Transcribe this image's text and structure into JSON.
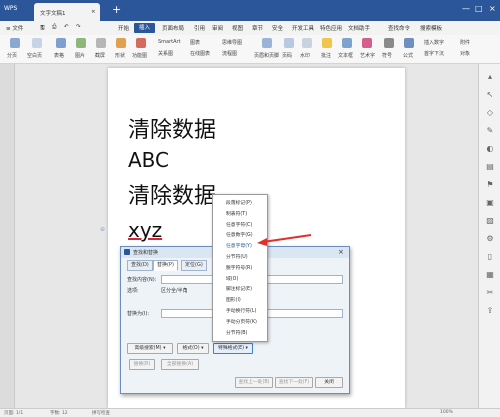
{
  "titlebar": {
    "app": "WPS",
    "tab": "文字文稿1",
    "close": "×",
    "new_tab": "+"
  },
  "menu": {
    "file": "≡ 文件",
    "items": [
      "开始",
      "插入",
      "页面布局",
      "引用",
      "审阅",
      "视图",
      "章节",
      "安全",
      "开发工具",
      "特色应用",
      "文档助手"
    ],
    "right": [
      "查找命令",
      "搜索模板"
    ],
    "active_index": 1
  },
  "ribbon": {
    "labels": [
      "分页",
      "空白页",
      "表格",
      "图片",
      "截屏",
      "形状",
      "功能图",
      "SmartArt",
      "关系图",
      "图表",
      "在线图表",
      "思维导图",
      "流程图",
      "页眉和页脚",
      "页码",
      "水印",
      "批注",
      "文本框",
      "艺术字",
      "符号",
      "公式",
      "插入数字",
      "首字下沉",
      "附件",
      "对象"
    ]
  },
  "document": {
    "lines": [
      "清除数据",
      "ABC",
      "清除数据",
      "xyz"
    ]
  },
  "dialog": {
    "title": "查找和替换",
    "tabs": [
      "查找(D)",
      "替换(P)",
      "定位(G)"
    ],
    "find_label": "查找内容(N):",
    "options_label": "选项:",
    "options_value": "区分全/半角",
    "replace_label": "替换为(I):",
    "btn_advanced": "高级搜索(M) ▾",
    "btn_format": "格式(O) ▾",
    "btn_special": "特殊格式(E) ▾",
    "btn_replace": "替换(R)",
    "btn_replace_all": "全部替换(A)",
    "btn_find_prev": "查找上一处(B)",
    "btn_find_next": "查找下一处(F)",
    "btn_close": "关闭"
  },
  "special_menu": {
    "items": [
      "段落标记(P)",
      "制表符(T)",
      "任意字符(C)",
      "任意数字(G)",
      "任意字母(Y)",
      "分节符(U)",
      "脱字符号(R)",
      "域(O)",
      "脚注标记(E)",
      "图形(I)",
      "手动换行符(L)",
      "手动分页符(K)",
      "分节符(B)"
    ],
    "highlighted_index": 4
  },
  "statusbar": {
    "page": "页面: 1/1",
    "words": "字数: 12",
    "spell": "拼写检查",
    "zoom": "100%"
  },
  "colors": {
    "title": "#2b579a",
    "accent": "#2b579a",
    "arrow": "#e0302c"
  }
}
